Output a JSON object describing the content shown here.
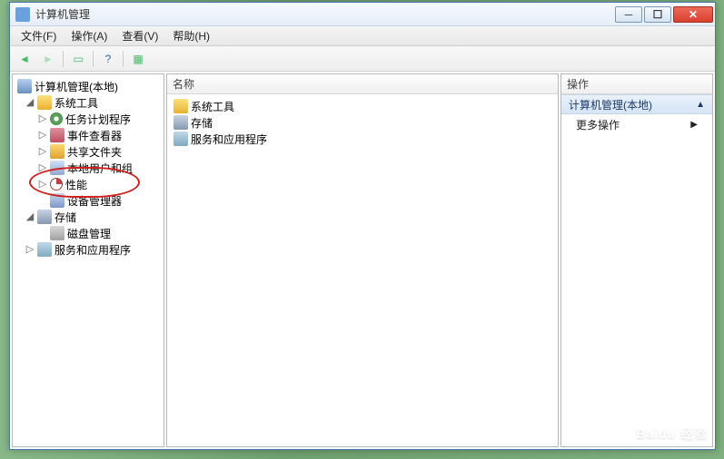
{
  "window": {
    "title": "计算机管理"
  },
  "menubar": {
    "file": "文件(F)",
    "action": "操作(A)",
    "view": "查看(V)",
    "help": "帮助(H)"
  },
  "tree": {
    "root": "计算机管理(本地)",
    "systools": "系统工具",
    "task": "任务计划程序",
    "event": "事件查看器",
    "share": "共享文件夹",
    "users": "本地用户和组",
    "perf": "性能",
    "devmgr": "设备管理器",
    "storage": "存储",
    "diskmgmt": "磁盘管理",
    "services": "服务和应用程序"
  },
  "mid": {
    "header": "名称",
    "systools": "系统工具",
    "storage": "存储",
    "services": "服务和应用程序"
  },
  "actions": {
    "header": "操作",
    "group": "计算机管理(本地)",
    "more": "更多操作"
  },
  "watermark": "Baidu 经验"
}
